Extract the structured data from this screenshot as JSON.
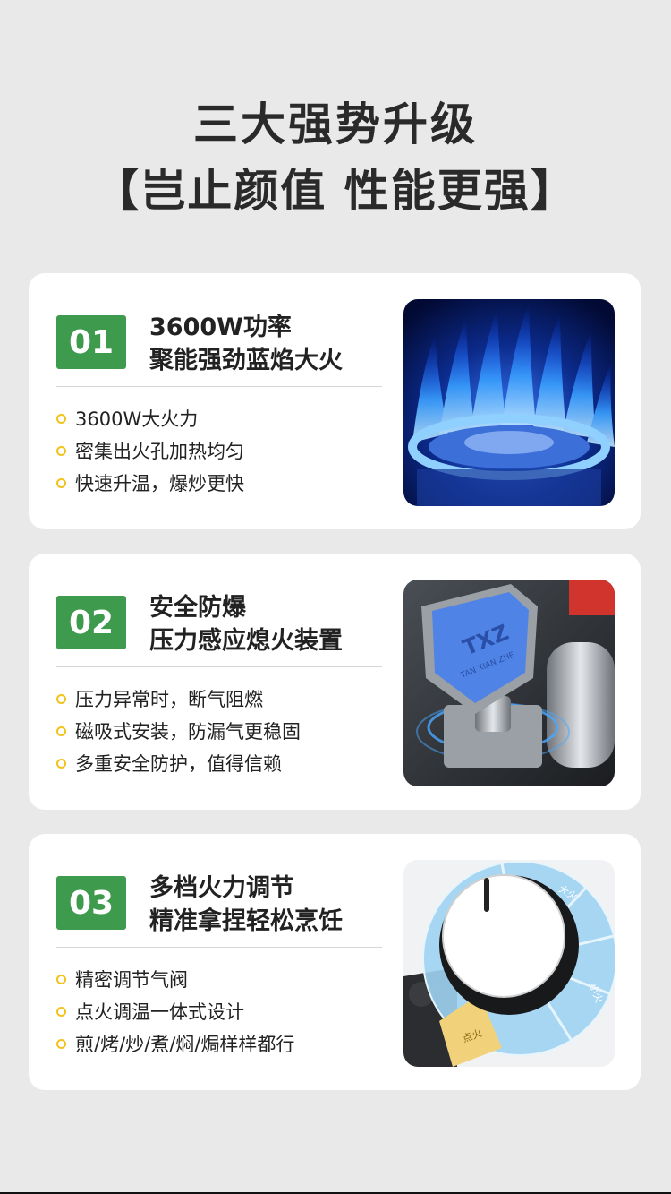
{
  "header": {
    "title_line1": "三大强势升级",
    "title_line2": "【岂止颜值 性能更强】"
  },
  "colors": {
    "background": "#e9e9e9",
    "card": "#ffffff",
    "badge_green": "#3e9a4c",
    "bullet_yellow": "#f2c21b"
  },
  "features": [
    {
      "number": "01",
      "heading_line1": "3600W功率",
      "heading_line2": "聚能强劲蓝焰大火",
      "bullets": [
        "3600W大火力",
        "密集出火孔加热均匀",
        "快速升温，爆炒更快"
      ],
      "image_icon": "blue-flame-burner-photo"
    },
    {
      "number": "02",
      "heading_line1": "安全防爆",
      "heading_line2": "压力感应熄火装置",
      "bullets": [
        "压力异常时，断气阻燃",
        "磁吸式安装，防漏气更稳固",
        "多重安全防护，值得信赖"
      ],
      "image_icon": "pressure-valve-shield-photo",
      "image_logo_text": "TAN XIAN ZHE"
    },
    {
      "number": "03",
      "heading_line1": "多档火力调节",
      "heading_line2": "精准拿捏轻松烹饪",
      "bullets": [
        "精密调节气阀",
        "点火调温一体式设计",
        "煎/烤/炒/煮/焖/焗样样都行"
      ],
      "image_icon": "control-knob-dial-photo",
      "image_labels": {
        "max": "大火",
        "min": "小火",
        "ignite": "点火"
      }
    }
  ]
}
